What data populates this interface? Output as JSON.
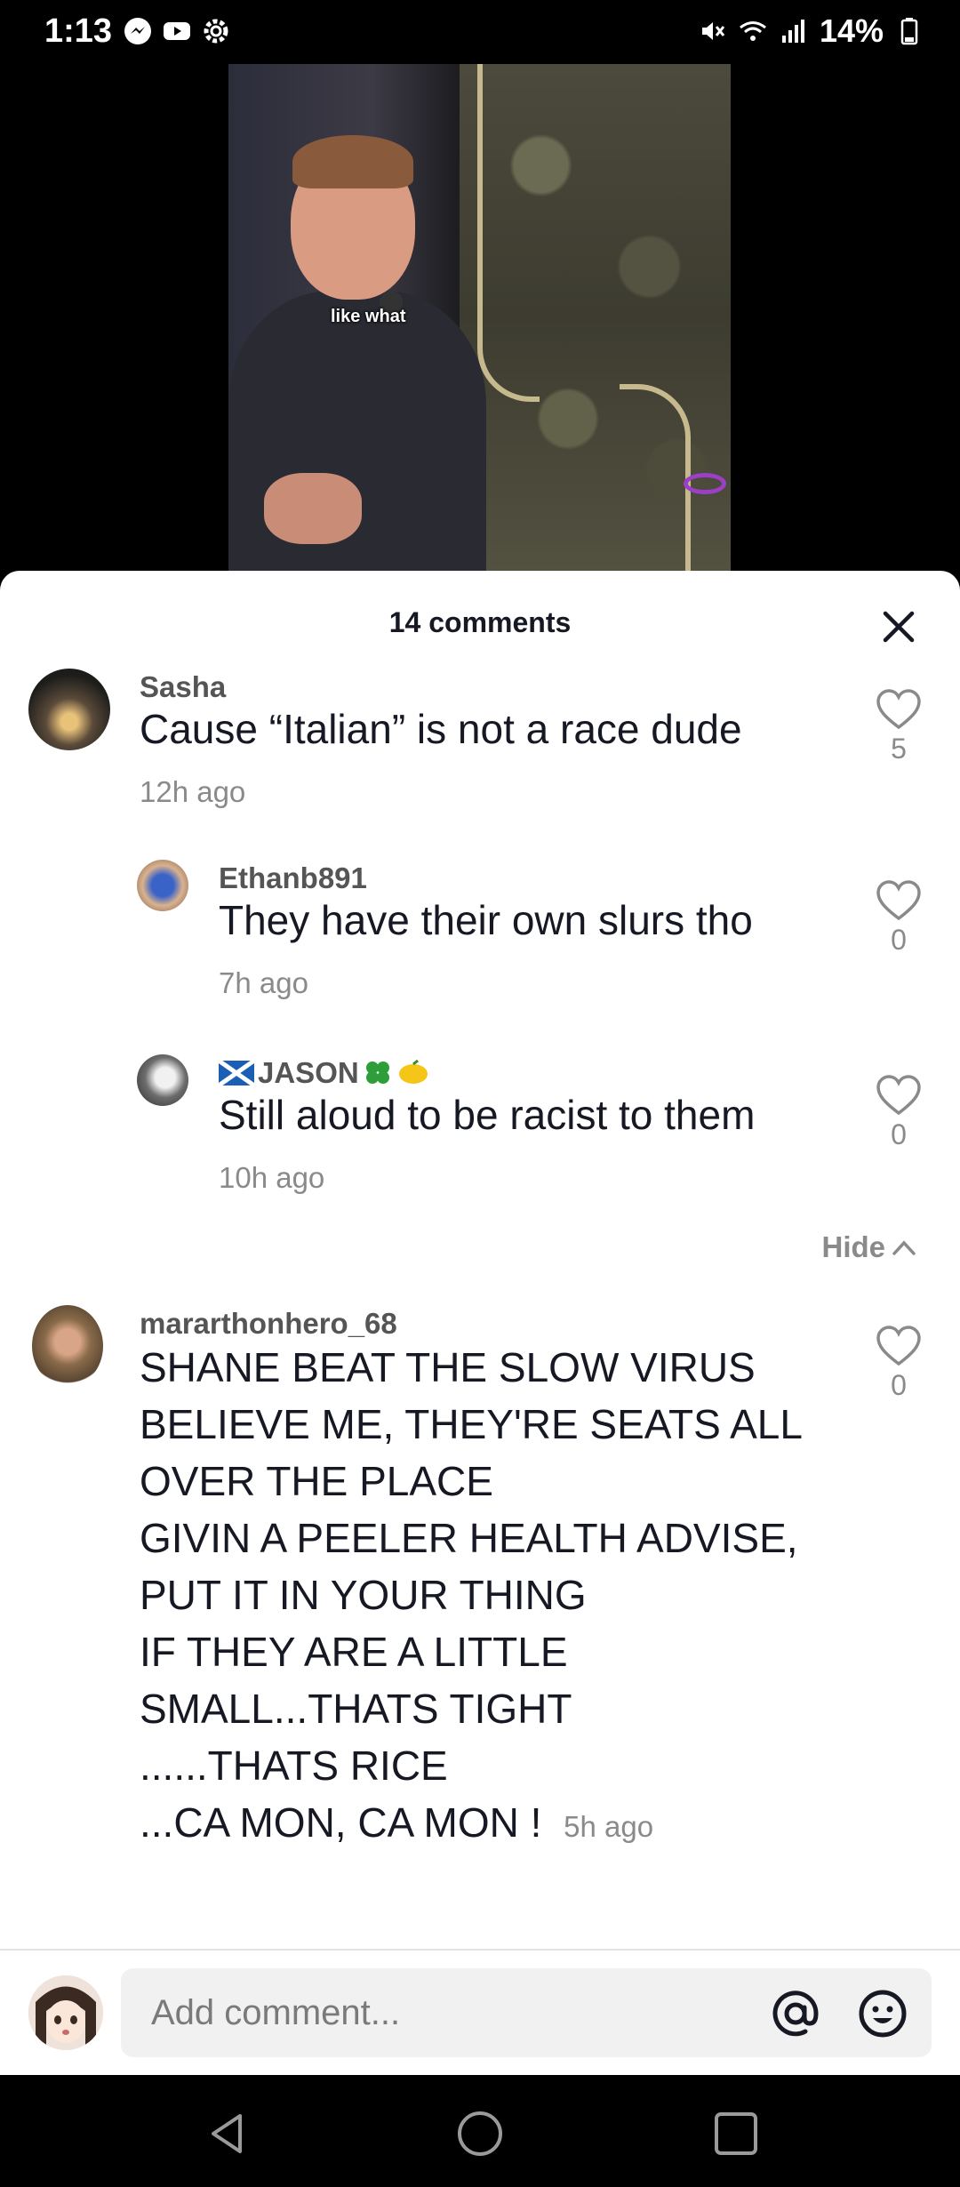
{
  "status_bar": {
    "time": "1:13",
    "battery": "14%",
    "left_icons": [
      "messenger-icon",
      "youtube-icon",
      "settings-icon"
    ],
    "right_icons": [
      "mute-icon",
      "wifi-icon",
      "signal-icon",
      "battery-icon"
    ]
  },
  "video": {
    "caption": "like what"
  },
  "sheet": {
    "title": "14 comments"
  },
  "comments": [
    {
      "username": "Sasha",
      "text": "Cause “Italian” is not a race dude",
      "time": "12h ago",
      "likes": "5"
    },
    {
      "username": "Ethanb891",
      "text": "They have their own slurs tho",
      "time": "7h ago",
      "likes": "0"
    },
    {
      "username": "🏴JASON🍀🍋",
      "username_text": "JASON",
      "text": "Still aloud to be racist to them",
      "time": "10h ago",
      "likes": "0"
    },
    {
      "username": "mararthonhero_68",
      "text_lines": [
        "SHANE BEAT THE SLOW VIRUS",
        "BELIEVE ME, THEY'RE SEATS ALL",
        "OVER THE PLACE",
        "GIVIN A PEELER HEALTH ADVISE,",
        "PUT IT IN YOUR THING",
        "IF THEY ARE A LITTLE",
        "SMALL...THATS TIGHT",
        "......THATS RICE",
        "...CA MON, CA MON !"
      ],
      "time": "5h ago",
      "likes": "0"
    }
  ],
  "hide_label": "Hide",
  "input": {
    "placeholder": "Add comment..."
  },
  "colors": {
    "accent_text": "#161823",
    "muted": "#8a8a8a",
    "sheet_bg": "#ffffff"
  }
}
